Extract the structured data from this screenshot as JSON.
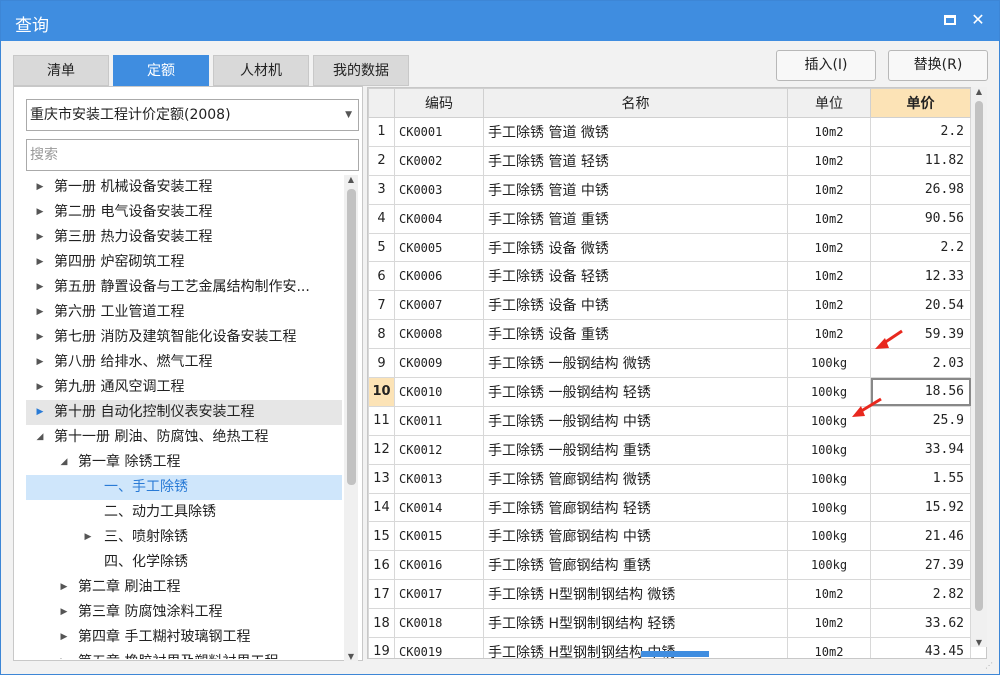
{
  "window": {
    "title": "查询"
  },
  "tabs": [
    "清单",
    "定额",
    "人材机",
    "我的数据"
  ],
  "actions": {
    "insert": "插入(I)",
    "replace": "替换(R)"
  },
  "left": {
    "library": "重庆市安装工程计价定额(2008)",
    "search_placeholder": "搜索",
    "tree": [
      {
        "label": "第一册 机械设备安装工程",
        "level": 0,
        "exp": "▶"
      },
      {
        "label": "第二册 电气设备安装工程",
        "level": 0,
        "exp": "▶"
      },
      {
        "label": "第三册 热力设备安装工程",
        "level": 0,
        "exp": "▶"
      },
      {
        "label": "第四册 炉窑砌筑工程",
        "level": 0,
        "exp": "▶"
      },
      {
        "label": "第五册 静置设备与工艺金属结构制作安...",
        "level": 0,
        "exp": "▶"
      },
      {
        "label": "第六册 工业管道工程",
        "level": 0,
        "exp": "▶"
      },
      {
        "label": "第七册 消防及建筑智能化设备安装工程",
        "level": 0,
        "exp": "▶"
      },
      {
        "label": "第八册 给排水、燃气工程",
        "level": 0,
        "exp": "▶"
      },
      {
        "label": "第九册 通风空调工程",
        "level": 0,
        "exp": "▶"
      },
      {
        "label": "第十册 自动化控制仪表安装工程",
        "level": 0,
        "exp": "▶",
        "state": "hl"
      },
      {
        "label": "第十一册 刷油、防腐蚀、绝热工程",
        "level": 0,
        "exp": "◢"
      },
      {
        "label": "第一章 除锈工程",
        "level": 1,
        "exp": "◢"
      },
      {
        "label": "一、手工除锈",
        "level": 2,
        "exp": "",
        "state": "sel"
      },
      {
        "label": "二、动力工具除锈",
        "level": 2,
        "exp": ""
      },
      {
        "label": "三、喷射除锈",
        "level": 2,
        "exp": "▶"
      },
      {
        "label": "四、化学除锈",
        "level": 2,
        "exp": ""
      },
      {
        "label": "第二章 刷油工程",
        "level": 1,
        "exp": "▶"
      },
      {
        "label": "第三章 防腐蚀涂料工程",
        "level": 1,
        "exp": "▶"
      },
      {
        "label": "第四章 手工糊衬玻璃钢工程",
        "level": 1,
        "exp": "▶"
      },
      {
        "label": "第五章 橡胶衬里及塑料衬里工程",
        "level": 1,
        "exp": "▶"
      }
    ]
  },
  "grid": {
    "headers": [
      "编码",
      "名称",
      "单位",
      "单价"
    ],
    "current_row": 10,
    "rows": [
      {
        "n": "1",
        "code": "CK0001",
        "name": "手工除锈 管道 微锈",
        "unit": "10m2",
        "price": "2.2"
      },
      {
        "n": "2",
        "code": "CK0002",
        "name": "手工除锈 管道 轻锈",
        "unit": "10m2",
        "price": "11.82"
      },
      {
        "n": "3",
        "code": "CK0003",
        "name": "手工除锈 管道 中锈",
        "unit": "10m2",
        "price": "26.98"
      },
      {
        "n": "4",
        "code": "CK0004",
        "name": "手工除锈 管道 重锈",
        "unit": "10m2",
        "price": "90.56"
      },
      {
        "n": "5",
        "code": "CK0005",
        "name": "手工除锈 设备 微锈",
        "unit": "10m2",
        "price": "2.2"
      },
      {
        "n": "6",
        "code": "CK0006",
        "name": "手工除锈 设备 轻锈",
        "unit": "10m2",
        "price": "12.33"
      },
      {
        "n": "7",
        "code": "CK0007",
        "name": "手工除锈 设备 中锈",
        "unit": "10m2",
        "price": "20.54"
      },
      {
        "n": "8",
        "code": "CK0008",
        "name": "手工除锈 设备 重锈",
        "unit": "10m2",
        "price": "59.39"
      },
      {
        "n": "9",
        "code": "CK0009",
        "name": "手工除锈 一般钢结构 微锈",
        "unit": "100kg",
        "price": "2.03"
      },
      {
        "n": "10",
        "code": "CK0010",
        "name": "手工除锈 一般钢结构 轻锈",
        "unit": "100kg",
        "price": "18.56"
      },
      {
        "n": "11",
        "code": "CK0011",
        "name": "手工除锈 一般钢结构 中锈",
        "unit": "100kg",
        "price": "25.9"
      },
      {
        "n": "12",
        "code": "CK0012",
        "name": "手工除锈 一般钢结构 重锈",
        "unit": "100kg",
        "price": "33.94"
      },
      {
        "n": "13",
        "code": "CK0013",
        "name": "手工除锈 管廊钢结构 微锈",
        "unit": "100kg",
        "price": "1.55"
      },
      {
        "n": "14",
        "code": "CK0014",
        "name": "手工除锈 管廊钢结构 轻锈",
        "unit": "100kg",
        "price": "15.92"
      },
      {
        "n": "15",
        "code": "CK0015",
        "name": "手工除锈 管廊钢结构 中锈",
        "unit": "100kg",
        "price": "21.46"
      },
      {
        "n": "16",
        "code": "CK0016",
        "name": "手工除锈 管廊钢结构 重锈",
        "unit": "100kg",
        "price": "27.39"
      },
      {
        "n": "17",
        "code": "CK0017",
        "name": "手工除锈 H型钢制钢结构 微锈",
        "unit": "10m2",
        "price": "2.82"
      },
      {
        "n": "18",
        "code": "CK0018",
        "name": "手工除锈 H型钢制钢结构 轻锈",
        "unit": "10m2",
        "price": "33.62"
      },
      {
        "n": "19",
        "code": "CK0019",
        "name": "手工除锈 H型钢制钢结构 中锈",
        "unit": "10m2",
        "price": "43.45"
      }
    ]
  },
  "colors": {
    "accent": "#3f8de0",
    "header_highlight": "#fce3b6",
    "annotation": "#e8281e"
  }
}
